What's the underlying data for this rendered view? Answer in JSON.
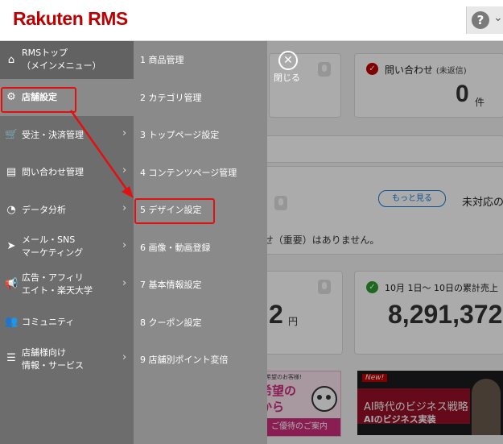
{
  "header": {
    "logo": "Rakuten RMS",
    "help_icon": "?",
    "dropdown_icon": "chevron-down"
  },
  "dashboard": {
    "inquiry_title": "問い合わせ",
    "inquiry_subtitle": "(未返信)",
    "inquiry_count": "0",
    "inquiry_unit": "件",
    "more_button": "もっと見る",
    "unhandled_label": "未対応の",
    "notice_text": "らせ（重要）はありません。",
    "left_amount_fragment": "2",
    "yen_unit": "円",
    "sales_title": "10月 1日～ 10日の累計売上",
    "sales_amount": "8,291,372",
    "banner1_top": "ご希望のお客様!",
    "banner1_main": "希望の\nから",
    "banner1_bottom": "ご優待のご案内",
    "banner2_new": "New!",
    "banner2_line1": "AI時代のビジネス戦略",
    "banner2_line2": "AIのビジネス実装"
  },
  "menu": {
    "close_label": "閉じる",
    "left_items": [
      {
        "label": "RMSトップ\n（メインメニュー）",
        "icon": "home-icon",
        "has_submenu": false
      },
      {
        "label": "店舗設定",
        "icon": "gear-icon",
        "has_submenu": false,
        "active": true
      },
      {
        "label": "受注・決済管理",
        "icon": "cart-icon",
        "has_submenu": true
      },
      {
        "label": "問い合わせ管理",
        "icon": "chat-icon",
        "has_submenu": true
      },
      {
        "label": "データ分析",
        "icon": "pie-chart-icon",
        "has_submenu": true
      },
      {
        "label": "メール・SNS\nマーケティング",
        "icon": "paper-plane-icon",
        "has_submenu": true
      },
      {
        "label": "広告・アフィリ\nエイト・楽天大学",
        "icon": "megaphone-icon",
        "has_submenu": true
      },
      {
        "label": "コミュニティ",
        "icon": "people-icon",
        "has_submenu": false
      },
      {
        "label": "店舗様向け\n情報・サービス",
        "icon": "list-icon",
        "has_submenu": true
      }
    ],
    "sub_items": [
      "1 商品管理",
      "2 カテゴリ管理",
      "3 トップページ設定",
      "4 コンテンツページ管理",
      "5 デザイン設定",
      "6 画像・動画登録",
      "7 基本情報設定",
      "8 クーポン設定",
      "9 店舗別ポイント変倍"
    ]
  },
  "colors": {
    "brand": "#bf0000",
    "highlight": "#e21010",
    "nav_bg": "#6d6d6d",
    "sub_bg": "#8a8a8a"
  }
}
